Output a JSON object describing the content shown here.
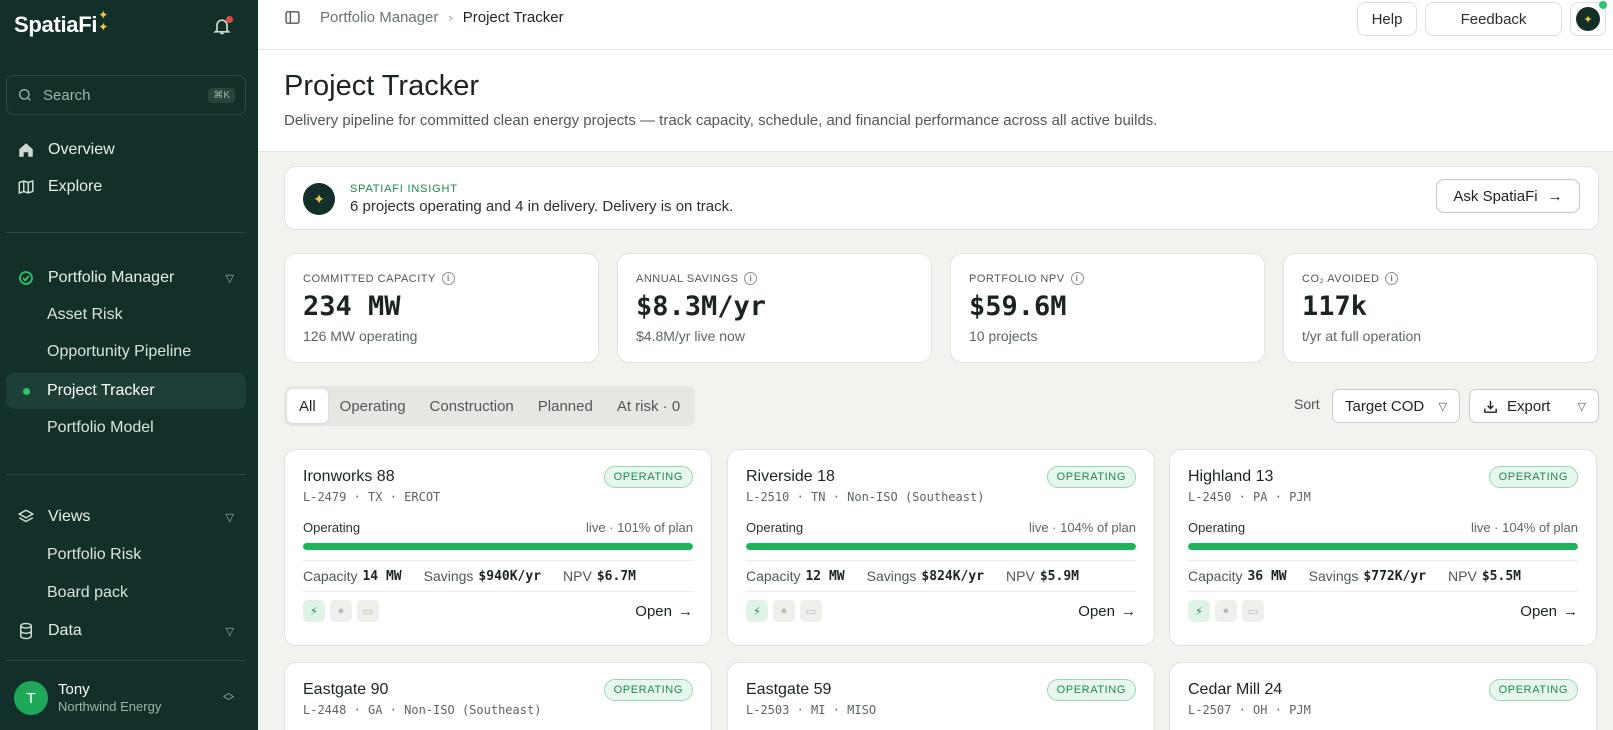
{
  "sidebar": {
    "brand": "SpatiaFi",
    "search": {
      "placeholder": "Search",
      "shortcut": "⌘K"
    },
    "nav": {
      "overview": "Overview",
      "explore": "Explore",
      "portfolio_manager": "Portfolio Manager",
      "asset_risk": "Asset Risk",
      "opportunity_pipeline": "Opportunity Pipeline",
      "project_tracker": "Project Tracker",
      "portfolio_model": "Portfolio Model",
      "views": "Views",
      "portfolio_risk": "Portfolio Risk",
      "board_pack": "Board pack",
      "data": "Data"
    },
    "user": {
      "initial": "T",
      "name": "Tony",
      "org": "Northwind Energy"
    }
  },
  "topbar": {
    "breadcrumb": [
      "Portfolio Manager",
      "Project Tracker"
    ],
    "help": "Help",
    "feedback": "Feedback"
  },
  "header": {
    "title": "Project Tracker",
    "subtitle": "Delivery pipeline for committed clean energy projects — track capacity, schedule, and financial performance across all active builds."
  },
  "insight": {
    "label": "SPATIAFI INSIGHT",
    "text": "6 projects operating and 4 in delivery. Delivery is on track.",
    "button": "Ask SpatiaFi"
  },
  "kpis": [
    {
      "label": "COMMITTED CAPACITY",
      "value": "234 MW",
      "sub": "126 MW operating"
    },
    {
      "label": "ANNUAL SAVINGS",
      "value": "$8.3M/yr",
      "sub": "$4.8M/yr live now"
    },
    {
      "label": "PORTFOLIO NPV",
      "value": "$59.6M",
      "sub": "10 projects"
    },
    {
      "label": "CO₂ AVOIDED",
      "value": "117k",
      "sub": "t/yr at full operation"
    }
  ],
  "filters": {
    "tabs": [
      "All",
      "Operating",
      "Construction",
      "Planned",
      "At risk · 0"
    ],
    "sort_label": "Sort",
    "sort_value": "Target COD",
    "export": "Export"
  },
  "projects": [
    {
      "name": "Ironworks 88",
      "id": "L-2479 · TX · ERCOT",
      "status": "OPERATING",
      "stage": "Operating",
      "progress_text": "live · 101% of plan",
      "progress": 1.0,
      "capacity_label": "Capacity",
      "capacity": "14 MW",
      "savings_label": "Savings",
      "savings": "$940K/yr",
      "npv_label": "NPV",
      "npv": "$6.7M",
      "open": "Open"
    },
    {
      "name": "Riverside 18",
      "id": "L-2510 · TN · Non-ISO (Southeast)",
      "status": "OPERATING",
      "stage": "Operating",
      "progress_text": "live · 104% of plan",
      "progress": 1.0,
      "capacity_label": "Capacity",
      "capacity": "12 MW",
      "savings_label": "Savings",
      "savings": "$824K/yr",
      "npv_label": "NPV",
      "npv": "$5.9M",
      "open": "Open"
    },
    {
      "name": "Highland 13",
      "id": "L-2450 · PA · PJM",
      "status": "OPERATING",
      "stage": "Operating",
      "progress_text": "live · 104% of plan",
      "progress": 1.0,
      "capacity_label": "Capacity",
      "capacity": "36 MW",
      "savings_label": "Savings",
      "savings": "$772K/yr",
      "npv_label": "NPV",
      "npv": "$5.5M",
      "open": "Open"
    },
    {
      "name": "Eastgate 90",
      "id": "L-2448 · GA · Non-ISO (Southeast)",
      "status": "OPERATING"
    },
    {
      "name": "Eastgate 59",
      "id": "L-2503 · MI · MISO",
      "status": "OPERATING"
    },
    {
      "name": "Cedar Mill 24",
      "id": "L-2507 · OH · PJM",
      "status": "OPERATING"
    }
  ]
}
